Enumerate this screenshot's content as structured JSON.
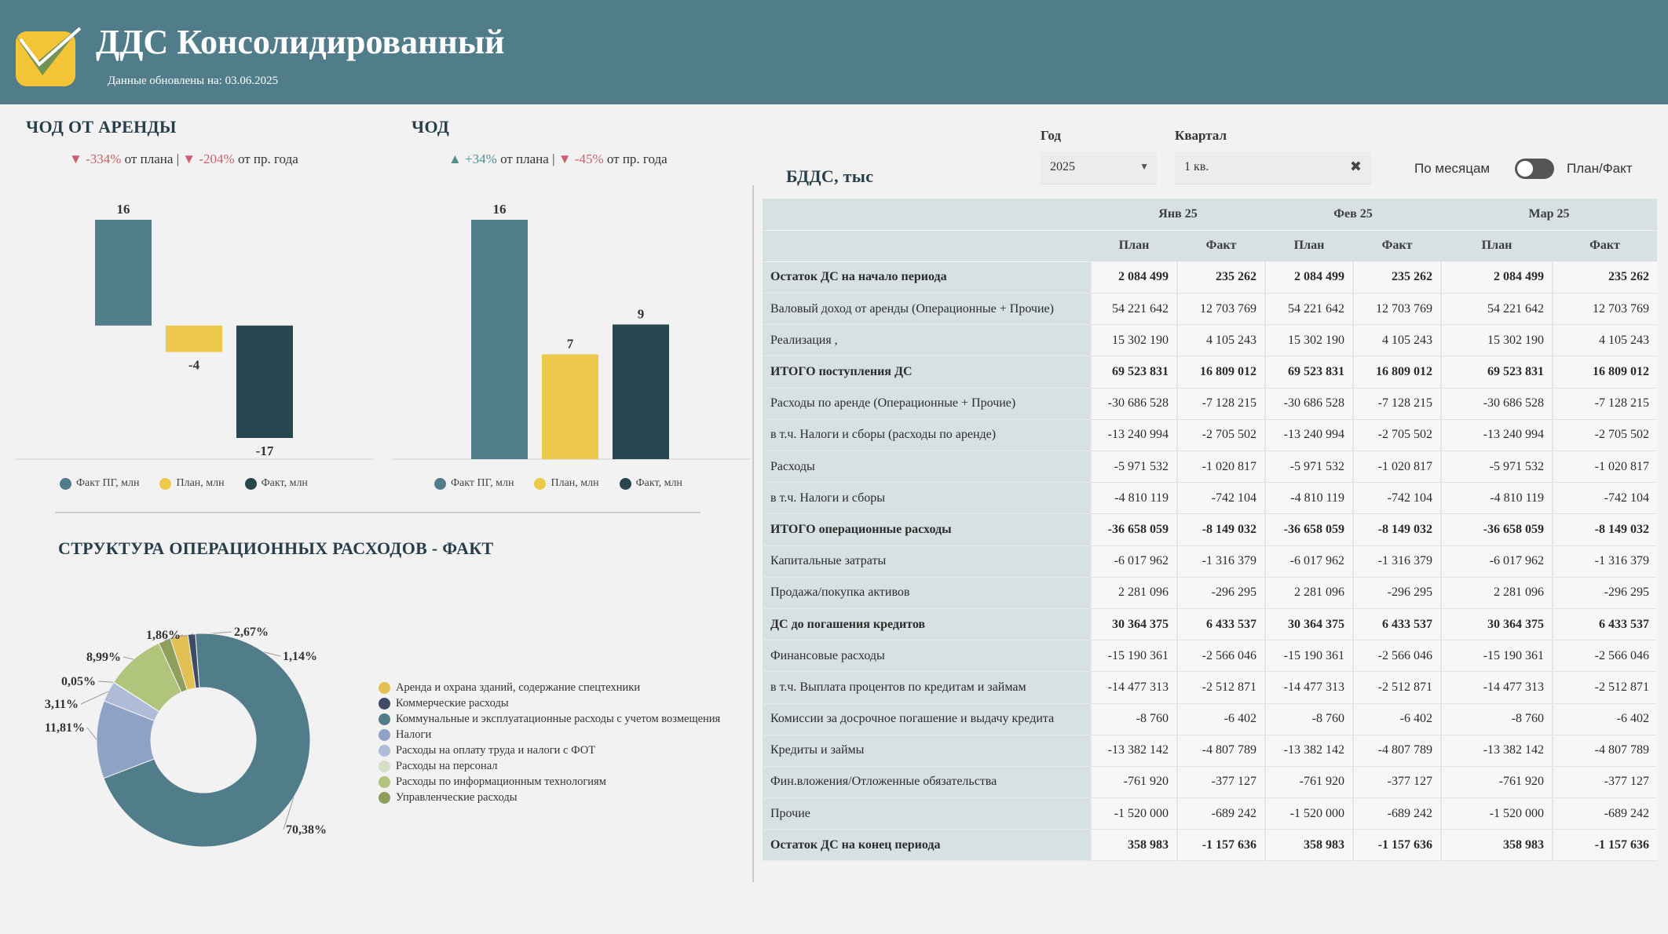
{
  "header": {
    "title": "ДДС Консолидированный",
    "updated_label": "Данные обновлены на:",
    "updated_date": "03.06.2025",
    "colors": {
      "bar": "#517c89",
      "logo": "#f2c436"
    }
  },
  "kpi1": {
    "title": "ЧОД ОТ АРЕНДЫ",
    "plan_delta": "-334%",
    "plan_text": "от плана",
    "sep": "|",
    "py_delta": "-204%",
    "py_text": "от пр. года"
  },
  "kpi2": {
    "title": "ЧОД",
    "plan_delta": "+34%",
    "plan_text": "от плана",
    "sep": "|",
    "py_delta": "-45%",
    "py_text": "от пр. года"
  },
  "legend": {
    "fact_py": "Факт ПГ, млн",
    "plan": "План, млн",
    "fact": "Факт, млн"
  },
  "chart_data": [
    {
      "type": "bar",
      "categories": [
        "Факт ПГ, млн",
        "План, млн",
        "Факт, млн"
      ],
      "values": [
        16,
        -4,
        -17
      ],
      "colors": [
        "#517c89",
        "#ecc94b",
        "#284650"
      ]
    },
    {
      "type": "bar",
      "categories": [
        "Факт ПГ, млн",
        "План, млн",
        "Факт, млн"
      ],
      "values": [
        16,
        7,
        9
      ],
      "colors": [
        "#517c89",
        "#ecc94b",
        "#284650"
      ]
    },
    {
      "type": "pie",
      "title": "СТРУКТУРА ОПЕРАЦИОННЫХ РАСХОДОВ - ФАКТ",
      "donut": true,
      "labels": [
        "Аренда и охрана зданий, содержание спецтехники",
        "Коммерческие расходы",
        "Коммунальные и эксплуатационные расходы с учетом возмещения",
        "Налоги",
        "Расходы на оплату труда и налоги с ФОТ",
        "Расходы на персонал",
        "Расходы по информационным технологиям",
        "Управленческие расходы"
      ],
      "values": [
        2.67,
        1.14,
        70.38,
        11.81,
        3.11,
        0.05,
        8.99,
        1.86
      ],
      "value_labels": [
        "2,67%",
        "1,14%",
        "70,38%",
        "11,81%",
        "3,11%",
        "0,05%",
        "8,99%",
        "1,86%"
      ],
      "colors": [
        "#e3c054",
        "#3e4a66",
        "#517c89",
        "#8da2c4",
        "#aebcd8",
        "#d7dec6",
        "#b0c47c",
        "#8f9e5b"
      ]
    }
  ],
  "filters": {
    "year_label": "Год",
    "year_value": "2025",
    "quarter_label": "Квартал",
    "quarter_value": "1 кв.",
    "toggle_left": "По месяцам",
    "toggle_right": "План/Факт"
  },
  "table": {
    "title": "БДДС, тыс",
    "months": [
      "Янв 25",
      "Фев 25",
      "Мар 25"
    ],
    "subheaders": [
      "План",
      "Факт",
      "План",
      "Факт",
      "План",
      "Факт"
    ],
    "rows": [
      {
        "label": "Остаток ДС на начало периода",
        "bold": true,
        "v": [
          "2 084 499",
          "235 262",
          "2 084 499",
          "235 262",
          "2 084 499",
          "235 262"
        ]
      },
      {
        "label": "Валовый доход от аренды (Операционные + Прочие)",
        "bold": false,
        "v": [
          "54 221 642",
          "12 703 769",
          "54 221 642",
          "12 703 769",
          "54 221 642",
          "12 703 769"
        ]
      },
      {
        "label": "Реализация ,",
        "bold": false,
        "v": [
          "15 302 190",
          "4 105 243",
          "15 302 190",
          "4 105 243",
          "15 302 190",
          "4 105 243"
        ]
      },
      {
        "label": "ИТОГО поступления ДС",
        "bold": true,
        "v": [
          "69 523 831",
          "16 809 012",
          "69 523 831",
          "16 809 012",
          "69 523 831",
          "16 809 012"
        ]
      },
      {
        "label": "Расходы по аренде (Операционные + Прочие)",
        "bold": false,
        "v": [
          "-30 686 528",
          "-7 128 215",
          "-30 686 528",
          "-7 128 215",
          "-30 686 528",
          "-7 128 215"
        ]
      },
      {
        "label": "в т.ч. Налоги и сборы (расходы по аренде)",
        "bold": false,
        "v": [
          "-13 240 994",
          "-2 705 502",
          "-13 240 994",
          "-2 705 502",
          "-13 240 994",
          "-2 705 502"
        ]
      },
      {
        "label": "Расходы",
        "bold": false,
        "v": [
          "-5 971 532",
          "-1 020 817",
          "-5 971 532",
          "-1 020 817",
          "-5 971 532",
          "-1 020 817"
        ]
      },
      {
        "label": "в т.ч. Налоги и сборы",
        "bold": false,
        "v": [
          "-4 810 119",
          "-742 104",
          "-4 810 119",
          "-742 104",
          "-4 810 119",
          "-742 104"
        ]
      },
      {
        "label": "ИТОГО операционные расходы",
        "bold": true,
        "v": [
          "-36 658 059",
          "-8 149 032",
          "-36 658 059",
          "-8 149 032",
          "-36 658 059",
          "-8 149 032"
        ]
      },
      {
        "label": "Капитальные затраты",
        "bold": false,
        "v": [
          "-6 017 962",
          "-1 316 379",
          "-6 017 962",
          "-1 316 379",
          "-6 017 962",
          "-1 316 379"
        ]
      },
      {
        "label": "Продажа/покупка активов",
        "bold": false,
        "v": [
          "2 281 096",
          "-296 295",
          "2 281 096",
          "-296 295",
          "2 281 096",
          "-296 295"
        ]
      },
      {
        "label": "ДС до погашения кредитов",
        "bold": true,
        "v": [
          "30 364 375",
          "6 433 537",
          "30 364 375",
          "6 433 537",
          "30 364 375",
          "6 433 537"
        ]
      },
      {
        "label": "Финансовые расходы",
        "bold": false,
        "v": [
          "-15 190 361",
          "-2 566 046",
          "-15 190 361",
          "-2 566 046",
          "-15 190 361",
          "-2 566 046"
        ]
      },
      {
        "label": "в т.ч. Выплата процентов по кредитам и займам",
        "bold": false,
        "v": [
          "-14 477 313",
          "-2 512 871",
          "-14 477 313",
          "-2 512 871",
          "-14 477 313",
          "-2 512 871"
        ]
      },
      {
        "label": "Комиссии за досрочное погашение и выдачу кредита",
        "bold": false,
        "v": [
          "-8 760",
          "-6 402",
          "-8 760",
          "-6 402",
          "-8 760",
          "-6 402"
        ]
      },
      {
        "label": "Кредиты и займы",
        "bold": false,
        "v": [
          "-13 382 142",
          "-4 807 789",
          "-13 382 142",
          "-4 807 789",
          "-13 382 142",
          "-4 807 789"
        ]
      },
      {
        "label": "Фин.вложения/Отложенные обязательства",
        "bold": false,
        "v": [
          "-761 920",
          "-377 127",
          "-761 920",
          "-377 127",
          "-761 920",
          "-377 127"
        ]
      },
      {
        "label": "Прочие",
        "bold": false,
        "v": [
          "-1 520 000",
          "-689 242",
          "-1 520 000",
          "-689 242",
          "-1 520 000",
          "-689 242"
        ]
      },
      {
        "label": "Остаток ДС на конец периода",
        "bold": true,
        "v": [
          "358 983",
          "-1 157 636",
          "358 983",
          "-1 157 636",
          "358 983",
          "-1 157 636"
        ]
      }
    ]
  }
}
